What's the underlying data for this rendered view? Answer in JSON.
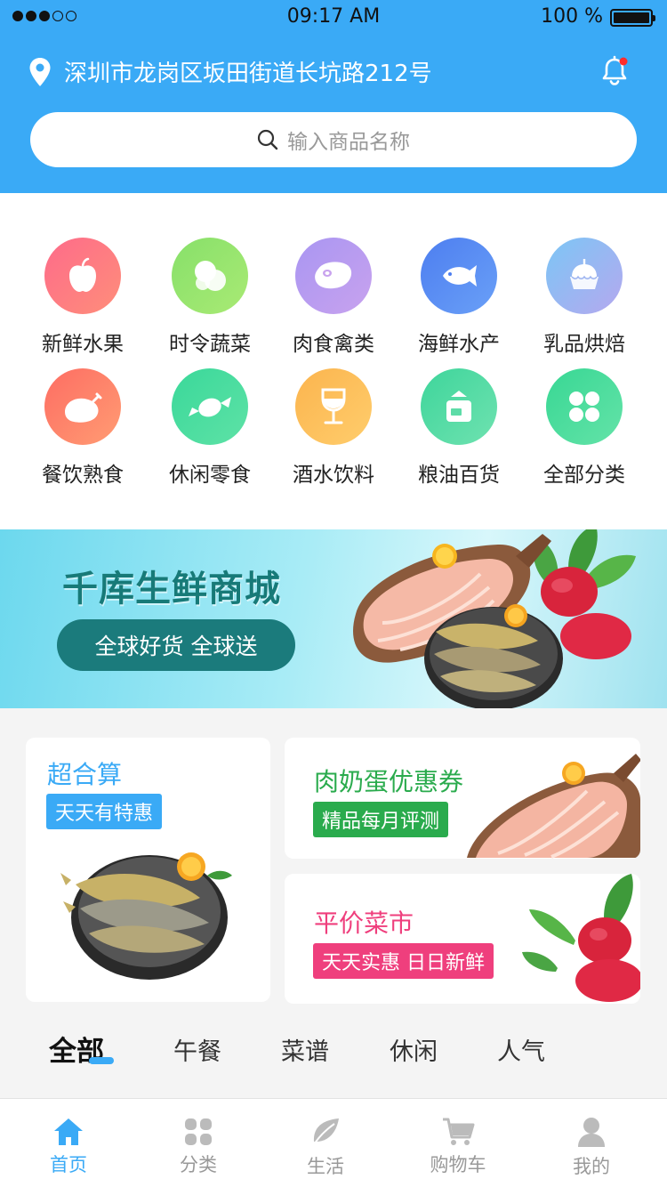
{
  "status_bar": {
    "time": "09:17 AM",
    "battery": "100 %"
  },
  "header": {
    "address": "深圳市龙岗区坂田街道长坑路212号",
    "search_placeholder": "输入商品名称"
  },
  "categories": [
    {
      "label": "新鲜水果",
      "icon": "apple-icon",
      "color_from": "#fd6b8a",
      "color_to": "#ff8e7a"
    },
    {
      "label": "时令蔬菜",
      "icon": "vegetable-icon",
      "color_from": "#87e06a",
      "color_to": "#a9ea74"
    },
    {
      "label": "肉食禽类",
      "icon": "meat-icon",
      "color_from": "#a996f2",
      "color_to": "#c8a2ee"
    },
    {
      "label": "海鲜水产",
      "icon": "fish-icon",
      "color_from": "#4d7ef0",
      "color_to": "#6aa0f7"
    },
    {
      "label": "乳品烘焙",
      "icon": "cake-icon",
      "color_from": "#7cc6f5",
      "color_to": "#b5a8ef"
    },
    {
      "label": "餐饮熟食",
      "icon": "chicken-icon",
      "color_from": "#fe6d63",
      "color_to": "#ff9c73"
    },
    {
      "label": "休闲零食",
      "icon": "candy-icon",
      "color_from": "#3ad89a",
      "color_to": "#5ee2a6"
    },
    {
      "label": "酒水饮料",
      "icon": "wine-glass-icon",
      "color_from": "#fbb44e",
      "color_to": "#ffcd6c"
    },
    {
      "label": "粮油百货",
      "icon": "rice-bag-icon",
      "color_from": "#3ed59b",
      "color_to": "#6fe2b0"
    },
    {
      "label": "全部分类",
      "icon": "grid-clover-icon",
      "color_from": "#38d794",
      "color_to": "#64e3a8"
    }
  ],
  "banner": {
    "title": "千库生鲜商城",
    "button": "全球好货  全球送"
  },
  "promos": {
    "deal": {
      "title": "超合算",
      "tag": "天天有特惠",
      "title_color": "#3aaaf6",
      "tag_color": "#3aaaf6"
    },
    "coupon": {
      "title": "肉奶蛋优惠券",
      "tag": "精品每月评测",
      "title_color": "#2aab4d",
      "tag_color": "#2aab4d"
    },
    "market": {
      "title": "平价菜市",
      "tag": "天天实惠 日日新鲜",
      "title_color": "#ef3f7d",
      "tag_color": "#ef3f7d"
    }
  },
  "tabs": [
    "全部",
    "午餐",
    "菜谱",
    "休闲",
    "人气"
  ],
  "bottom_nav": [
    {
      "label": "首页",
      "icon": "home-icon",
      "active": true
    },
    {
      "label": "分类",
      "icon": "category-grid-icon",
      "active": false
    },
    {
      "label": "生活",
      "icon": "leaf-icon",
      "active": false
    },
    {
      "label": "购物车",
      "icon": "cart-icon",
      "active": false
    },
    {
      "label": "我的",
      "icon": "user-icon",
      "active": false
    }
  ],
  "colors": {
    "primary": "#3aaaf6",
    "banner_accent": "#1b7b7c"
  }
}
